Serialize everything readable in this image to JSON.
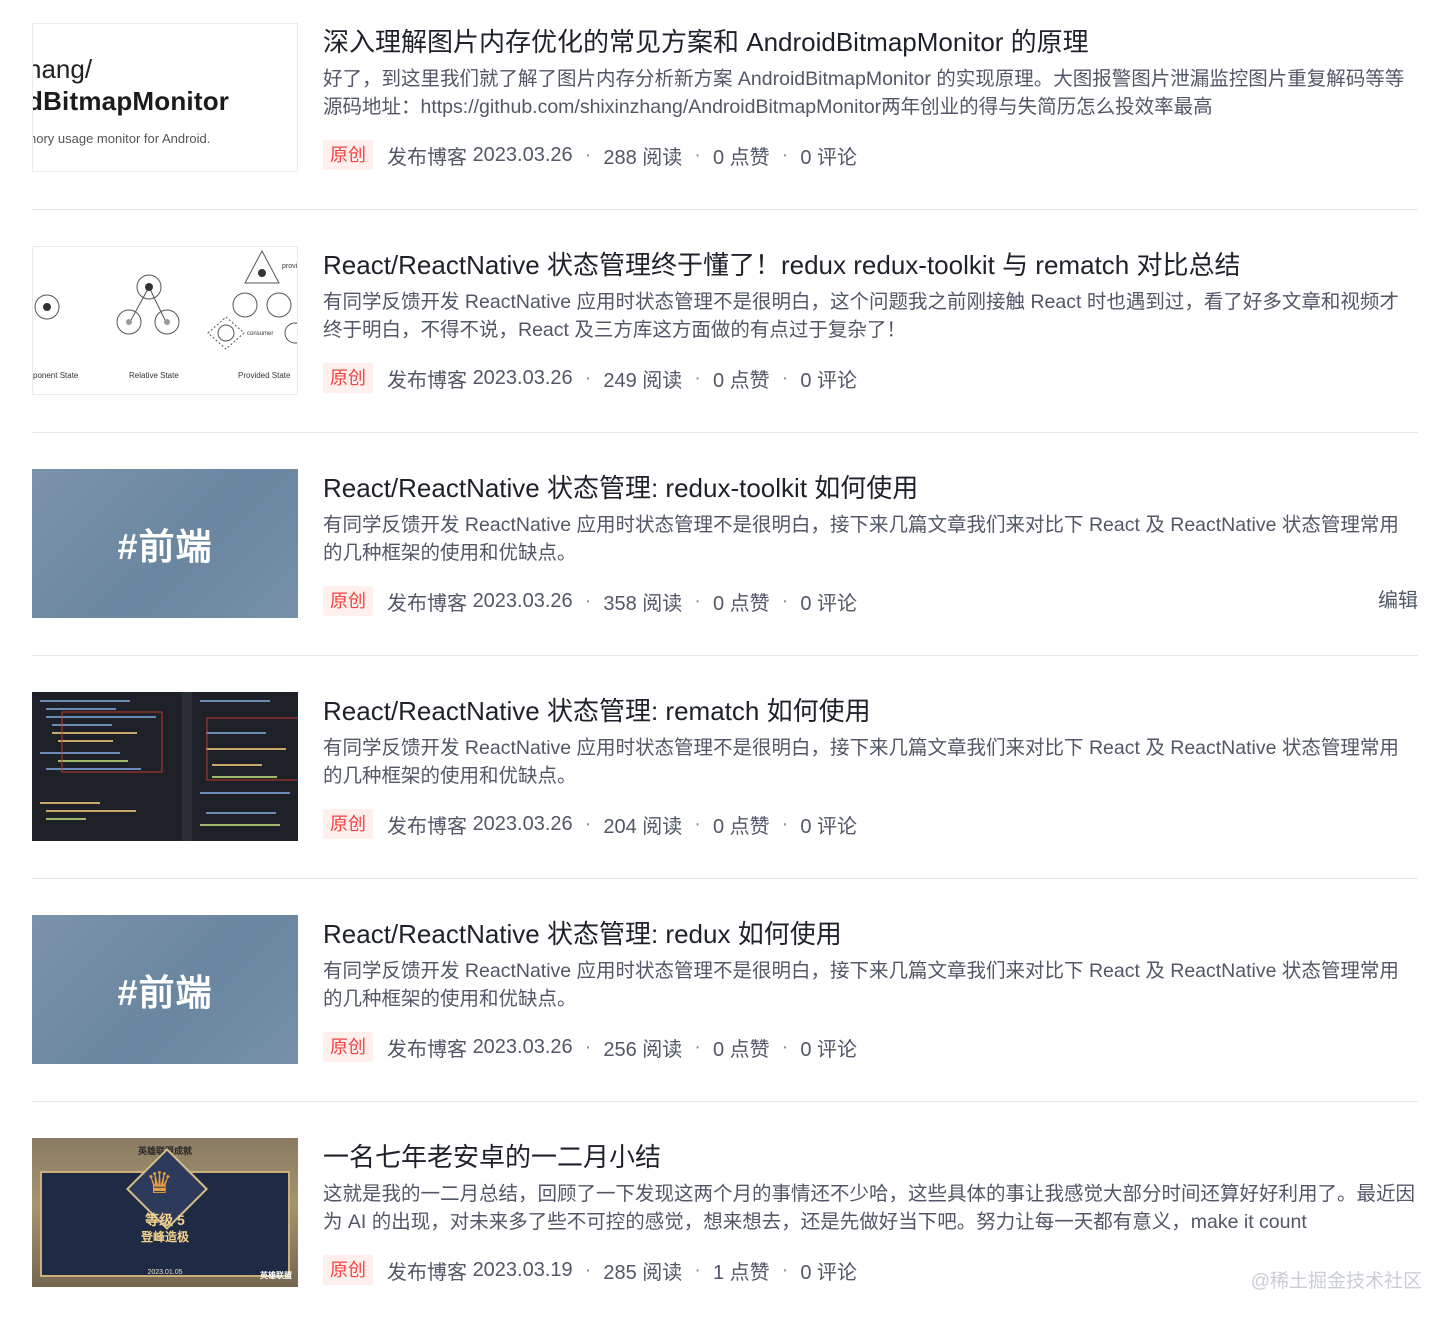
{
  "articles": [
    {
      "title": "深入理解图片内存优化的常见方案和 AndroidBitmapMonitor 的原理",
      "abstract": "好了，到这里我们就了解了图片内存分析新方案 AndroidBitmapMonitor 的实现原理。大图报警图片泄漏监控图片重复解码等等源码地址：https://github.com/shixinzhang/AndroidBitmapMonitor两年创业的得与失简历怎么投效率最高",
      "tag": "原创",
      "source": "发布博客",
      "date": "2023.03.26",
      "reads": "288 阅读",
      "likes": "0 点赞",
      "comments": "0 评论",
      "thumb": {
        "style": "light-text",
        "line1": "hang/",
        "line2": "dBitmapMonitor",
        "line3": "nory usage monitor for Android."
      }
    },
    {
      "title": "React/ReactNative 状态管理终于懂了！redux redux-toolkit 与 rematch 对比总结",
      "abstract": "有同学反馈开发 ReactNative 应用时状态管理不是很明白，这个问题我之前刚接触 React 时也遇到过，看了好多文章和视频才终于明白，不得不说，React 及三方库这方面做的有点过于复杂了！",
      "tag": "原创",
      "source": "发布博客",
      "date": "2023.03.26",
      "reads": "249 阅读",
      "likes": "0 点赞",
      "comments": "0 评论",
      "thumb": {
        "style": "state-diagram",
        "label_left": "ponent State",
        "label_mid": "Relative State",
        "label_right": "Provided State",
        "label_consumer": "consumer",
        "label_provider": "provi"
      }
    },
    {
      "title": "React/ReactNative 状态管理: redux-toolkit 如何使用",
      "abstract": "有同学反馈开发 ReactNative 应用时状态管理不是很明白，接下来几篇文章我们来对比下 React 及 ReactNative 状态管理常用的几种框架的使用和优缺点。",
      "tag": "原创",
      "source": "发布博客",
      "date": "2023.03.26",
      "reads": "358 阅读",
      "likes": "0 点赞",
      "comments": "0 评论",
      "edit_label": "编辑",
      "thumb": {
        "style": "blue-tag",
        "text": "#前端"
      }
    },
    {
      "title": "React/ReactNative 状态管理: rematch 如何使用",
      "abstract": "有同学反馈开发 ReactNative 应用时状态管理不是很明白，接下来几篇文章我们来对比下 React 及 ReactNative 状态管理常用的几种框架的使用和优缺点。",
      "tag": "原创",
      "source": "发布博客",
      "date": "2023.03.26",
      "reads": "204 阅读",
      "likes": "0 点赞",
      "comments": "0 评论",
      "thumb": {
        "style": "code-screenshot"
      }
    },
    {
      "title": "React/ReactNative 状态管理: redux 如何使用",
      "abstract": "有同学反馈开发 ReactNative 应用时状态管理不是很明白，接下来几篇文章我们来对比下 React 及 ReactNative 状态管理常用的几种框架的使用和优缺点。",
      "tag": "原创",
      "source": "发布博客",
      "date": "2023.03.26",
      "reads": "256 阅读",
      "likes": "0 点赞",
      "comments": "0 评论",
      "thumb": {
        "style": "blue-tag",
        "text": "#前端"
      }
    },
    {
      "title": "一名七年老安卓的一二月小结",
      "abstract": "这就是我的一二月总结，回顾了一下发现这两个月的事情还不少哈，这些具体的事让我感觉大部分时间还算好好利用了。最近因为 AI 的出现，对未来多了些不可控的感觉，想来想去，还是先做好当下吧。努力让每一天都有意义，make it count",
      "tag": "原创",
      "source": "发布博客",
      "date": "2023.03.19",
      "reads": "285 阅读",
      "likes": "1 点赞",
      "comments": "0 评论",
      "thumb": {
        "style": "game-badge",
        "top_text": "英雄联盟成就",
        "level": "等级 5",
        "badge_name": "登峰造极",
        "date_text": "2023.01.05",
        "logo": "英雄联盟"
      }
    }
  ],
  "watermark": "@稀土掘金技术社区"
}
